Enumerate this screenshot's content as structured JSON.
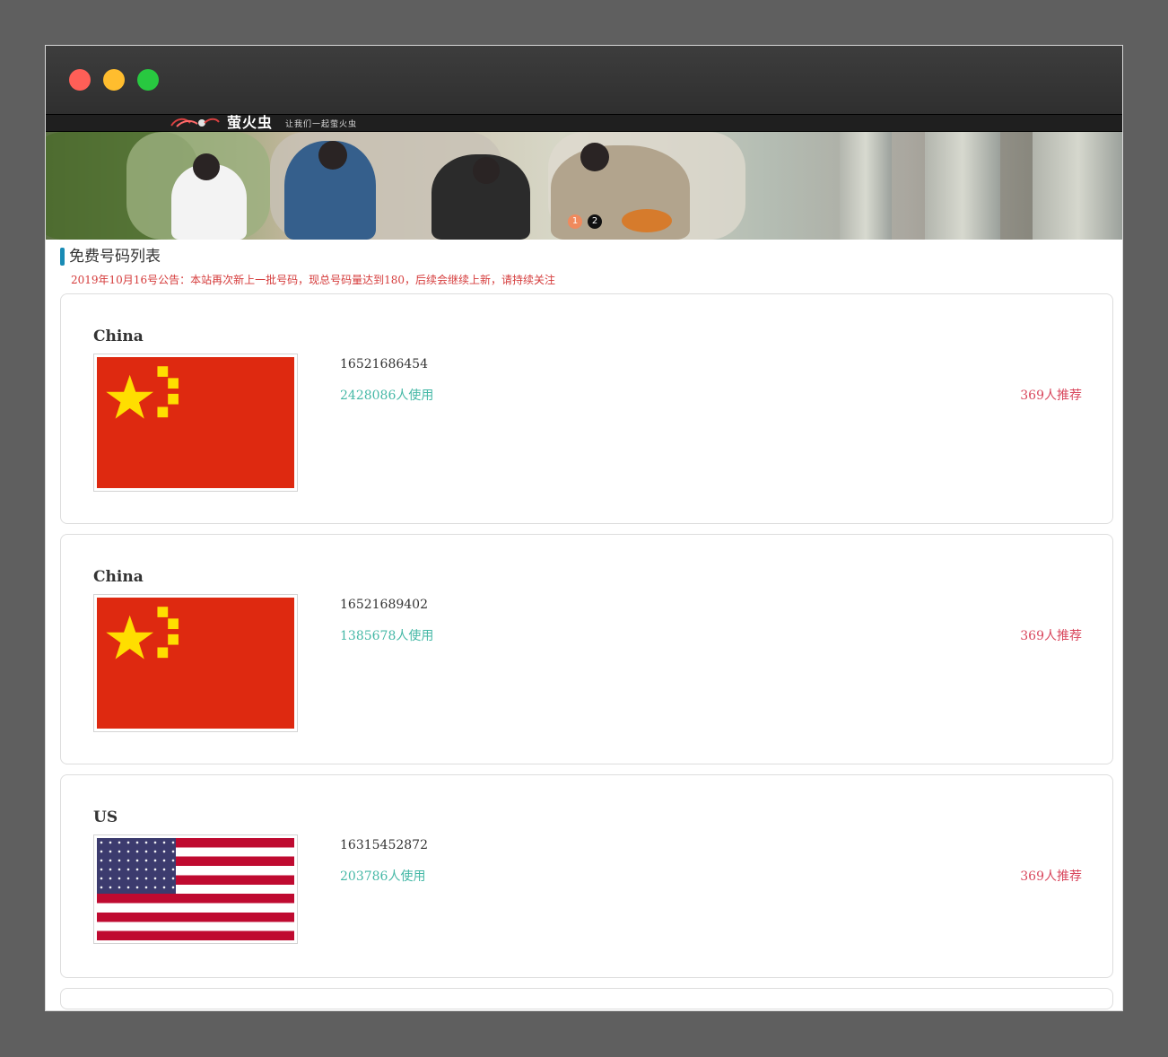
{
  "window": {
    "traffic_lights": [
      {
        "name": "close-light",
        "color": "#ff5f57"
      },
      {
        "name": "minimize-light",
        "color": "#ffbd2e"
      },
      {
        "name": "maximize-light",
        "color": "#28c840"
      }
    ]
  },
  "header": {
    "logo_text": "萤火虫",
    "slogan": "让我们一起萤火虫"
  },
  "banner": {
    "dots": [
      {
        "label": "1",
        "color": "#f08a5d",
        "active": true
      },
      {
        "label": "2",
        "color": "#111111",
        "active": false
      }
    ]
  },
  "section": {
    "title": "免费号码列表",
    "notice": "2019年10月16号公告：本站再次新上一批号码，现总号码量达到180，后续会继续上新，请持续关注"
  },
  "cards": [
    {
      "country": "China",
      "flag": "china-flag",
      "phone": "16521686454",
      "usage": "2428086人使用",
      "recommend": "369人推荐"
    },
    {
      "country": "China",
      "flag": "china-flag",
      "phone": "16521689402",
      "usage": "1385678人使用",
      "recommend": "369人推荐"
    },
    {
      "country": "US",
      "flag": "us-flag",
      "phone": "16315452872",
      "usage": "203786人使用",
      "recommend": "369人推荐"
    }
  ],
  "colors": {
    "accent": "#198bb5",
    "usage": "#45b8a6",
    "recommend": "#d9475d",
    "notice": "#d53b3b"
  }
}
